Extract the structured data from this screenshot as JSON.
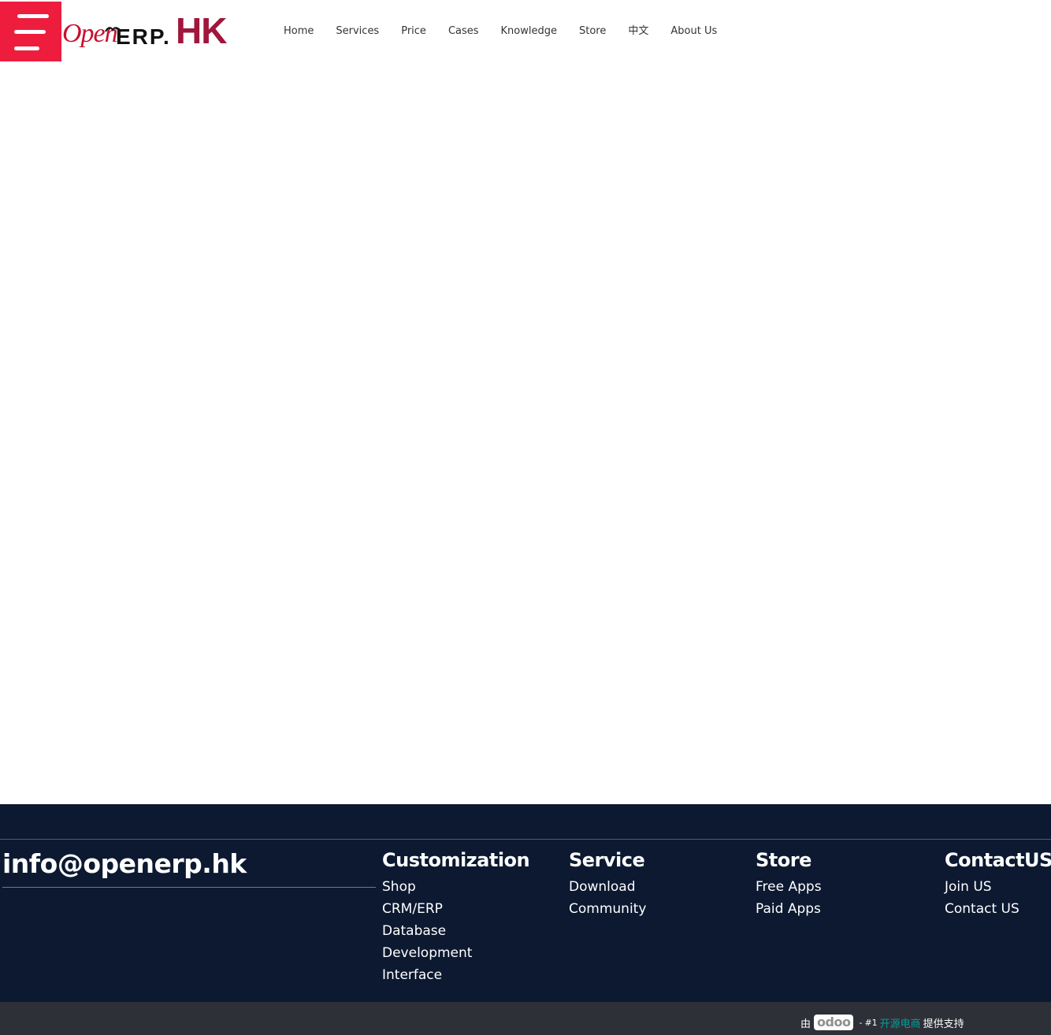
{
  "header": {
    "menu_icon": "hamburger-menu-icon",
    "logo": {
      "open": "Open",
      "erp": "ERP.",
      "hk": "HK"
    },
    "nav": [
      {
        "label": "Home"
      },
      {
        "label": "Services"
      },
      {
        "label": "Price"
      },
      {
        "label": "Cases"
      },
      {
        "label": "Knowledge"
      },
      {
        "label": "Store"
      },
      {
        "label": "中文"
      },
      {
        "label": "About Us"
      }
    ]
  },
  "footer": {
    "email": "info@openerp.hk",
    "columns": {
      "customization": {
        "title": "Customization",
        "links": [
          "Shop",
          "CRM/ERP",
          "Database",
          "Development",
          "Interface"
        ]
      },
      "service": {
        "title": "Service",
        "links": [
          "Download",
          "Community"
        ]
      },
      "store": {
        "title": "Store",
        "links": [
          "Free Apps",
          "Paid Apps"
        ]
      },
      "contact": {
        "title": "ContactUS",
        "links": [
          "Join US",
          "Contact US"
        ]
      }
    }
  },
  "bottombar": {
    "prefix": "由",
    "brand": "odoo",
    "separator": "-",
    "rank": "#1",
    "link": "开源电商",
    "suffix": "提供支持"
  },
  "colors": {
    "accent": "#ee1d3e",
    "footer_bg": "#0c1931",
    "bottombar_bg": "#2d3037",
    "brand_hk": "#a0163c",
    "link_teal": "#00a09d"
  }
}
